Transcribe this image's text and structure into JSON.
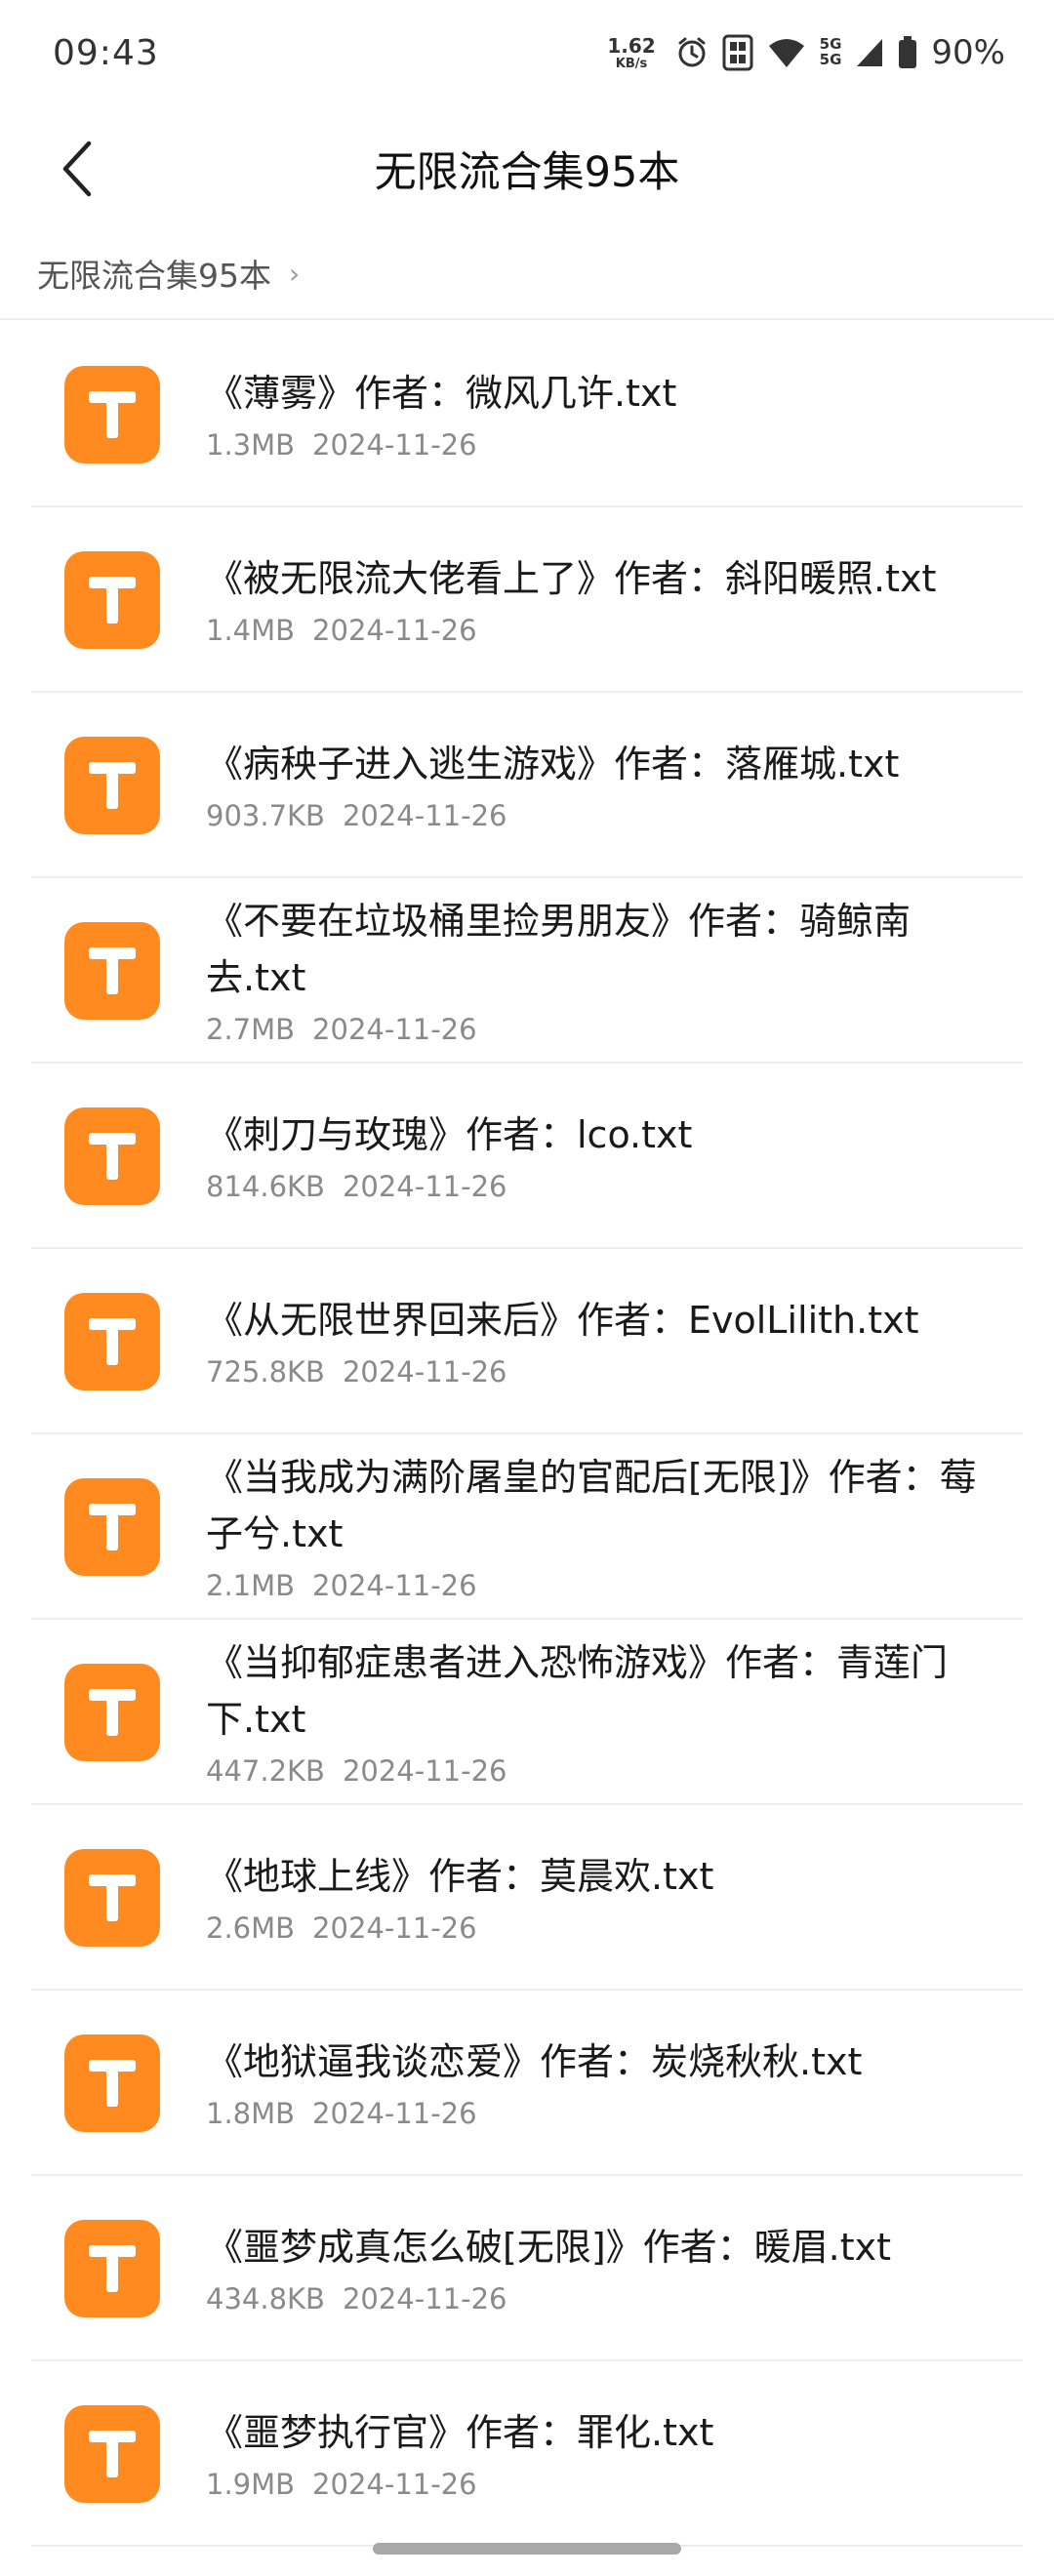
{
  "status_bar": {
    "time": "09:43",
    "net_speed_value": "1.62",
    "net_speed_unit": "KB/s",
    "network_top": "5G",
    "network_bottom": "5G",
    "battery": "90%"
  },
  "header": {
    "title": "无限流合集95本"
  },
  "breadcrumb": {
    "label": "无限流合集95本",
    "chevron": "›"
  },
  "colors": {
    "file_icon": "#ff8a1f",
    "meta_text": "#8a8a8a"
  },
  "icons": {
    "file": "txt-file-icon",
    "back": "back-arrow-icon"
  },
  "files": [
    {
      "name": "《薄雾》作者：微风几许.txt",
      "size": "1.3MB",
      "date": "2024-11-26"
    },
    {
      "name": "《被无限流大佬看上了》作者：斜阳暖照.txt",
      "size": "1.4MB",
      "date": "2024-11-26"
    },
    {
      "name": "《病秧子进入逃生游戏》作者：落雁城.txt",
      "size": "903.7KB",
      "date": "2024-11-26"
    },
    {
      "name": "《不要在垃圾桶里捡男朋友》作者：骑鲸南去.txt",
      "size": "2.7MB",
      "date": "2024-11-26"
    },
    {
      "name": "《刺刀与玫瑰》作者：lco.txt",
      "size": "814.6KB",
      "date": "2024-11-26"
    },
    {
      "name": "《从无限世界回来后》作者：EvolLilith.txt",
      "size": "725.8KB",
      "date": "2024-11-26"
    },
    {
      "name": "《当我成为满阶屠皇的官配后[无限]》作者：莓子兮.txt",
      "size": "2.1MB",
      "date": "2024-11-26"
    },
    {
      "name": "《当抑郁症患者进入恐怖游戏》作者：青莲门下.txt",
      "size": "447.2KB",
      "date": "2024-11-26"
    },
    {
      "name": "《地球上线》作者：莫晨欢.txt",
      "size": "2.6MB",
      "date": "2024-11-26"
    },
    {
      "name": "《地狱逼我谈恋爱》作者：炭烧秋秋.txt",
      "size": "1.8MB",
      "date": "2024-11-26"
    },
    {
      "name": "《噩梦成真怎么破[无限]》作者：暖眉.txt",
      "size": "434.8KB",
      "date": "2024-11-26"
    },
    {
      "name": "《噩梦执行官》作者：罪化.txt",
      "size": "1.9MB",
      "date": "2024-11-26"
    }
  ]
}
